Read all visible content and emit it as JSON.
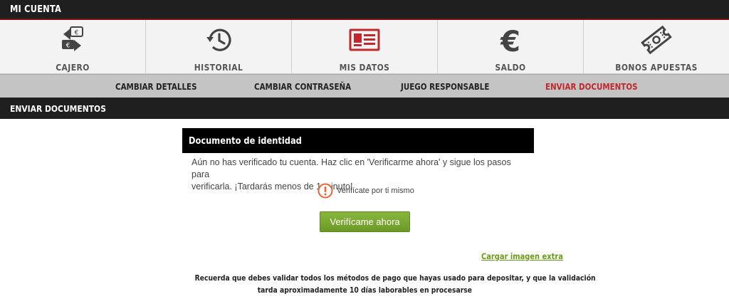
{
  "header": {
    "title": "MI CUENTA"
  },
  "nav": {
    "items": [
      {
        "label": "CAJERO",
        "icon": "cashier-icon"
      },
      {
        "label": "HISTORIAL",
        "icon": "history-icon"
      },
      {
        "label": "MIS DATOS",
        "icon": "id-card-icon",
        "active": true
      },
      {
        "label": "SALDO",
        "icon": "euro-icon"
      },
      {
        "label": "BONOS APUESTAS",
        "icon": "ticket-icon"
      }
    ]
  },
  "subnav": {
    "items": [
      {
        "label": "CAMBIAR DETALLES"
      },
      {
        "label": "CAMBIAR CONTRASEÑA"
      },
      {
        "label": "JUEGO RESPONSABLE"
      },
      {
        "label": "ENVIAR DOCUMENTOS",
        "active": true
      }
    ]
  },
  "section": {
    "title": "ENVIAR DOCUMENTOS"
  },
  "panel": {
    "title": "Documento de identidad",
    "message_line1": "Aún no has verificado tu cuenta. Haz clic en 'Verificarme ahora' y sigue los pasos para",
    "message_line2": "verificarla. ¡Tardarás menos de 1 minuto!",
    "verify_self_label": "Verifícate por ti mismo",
    "verify_button_label": "Verifícame ahora"
  },
  "extra_link": "Cargar imagen extra",
  "notice": {
    "line1": "Recuerda que debes validar todos los métodos de pago que hayas usado para depositar, y que la validación",
    "line2": "tarda aproximadamente 10 días laborables en procesarse"
  },
  "colors": {
    "accent_red": "#c0282d",
    "button_green": "#7aa832",
    "link_green": "#6a9a1e",
    "warning_orange": "#e8643a",
    "dark_bar": "#1f1f1f"
  }
}
